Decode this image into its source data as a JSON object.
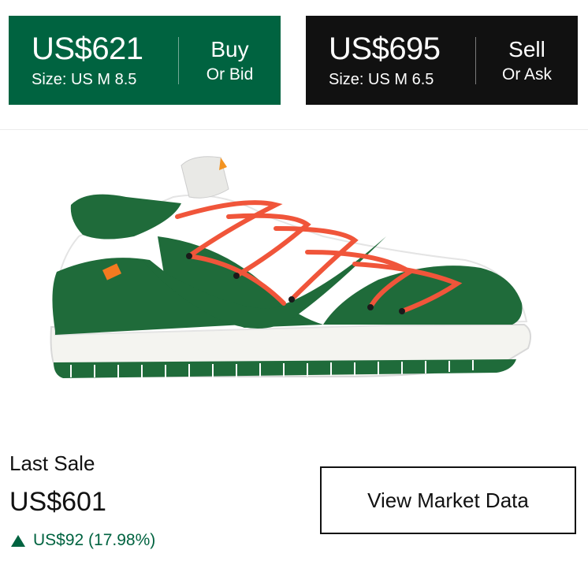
{
  "buy": {
    "price": "US$621",
    "size": "Size: US M 8.5",
    "label": "Buy",
    "sublabel": "Or Bid",
    "color": "#006340"
  },
  "sell": {
    "price": "US$695",
    "size": "Size: US M 6.5",
    "label": "Sell",
    "sublabel": "Or Ask",
    "color": "#111111"
  },
  "product": {
    "image_icon": "sneaker-image"
  },
  "last_sale": {
    "label": "Last Sale",
    "price": "US$601",
    "change": "US$92 (17.98%)",
    "change_direction_icon": "triangle-up-icon",
    "change_color": "#006340"
  },
  "market_button": {
    "label": "View Market Data"
  }
}
